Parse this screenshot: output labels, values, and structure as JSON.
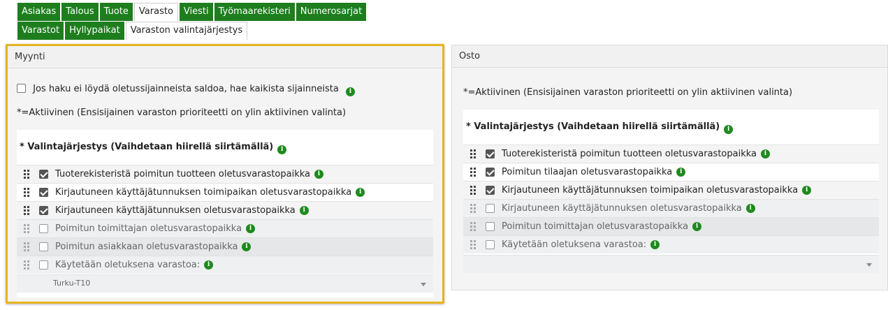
{
  "nav_row1": [
    "Asiakas",
    "Talous",
    "Tuote",
    "Varasto",
    "Viesti",
    "Työmaarekisteri",
    "Numerosarjat"
  ],
  "nav_row1_active": "Varasto",
  "nav_row2": [
    "Varastot",
    "Hyllypaikat",
    "Varaston valintajärjestys"
  ],
  "nav_row2_active": "Varaston valintajärjestys",
  "myynti": {
    "title": "Myynti",
    "fallback_checkbox_label": "Jos haku ei löydä oletussijainneista saldoa, hae kaikista sijainneista",
    "active_note": "*=Aktiivinen (Ensisijainen varaston prioriteetti on ylin aktiivinen valinta)",
    "order_title": "* Valintajärjestys (Vaihdetaan hiirellä siirtämällä)",
    "items": [
      {
        "label": "Tuoterekisteristä poimitun tuotteen oletusvarastopaikka",
        "checked": true
      },
      {
        "label": "Kirjautuneen käyttäjätunnuksen toimipaikan oletusvarastopaikka",
        "checked": true
      },
      {
        "label": "Kirjautuneen käyttäjätunnuksen oletusvarastopaikka",
        "checked": true
      },
      {
        "label": "Poimitun toimittajan oletusvarastopaikka",
        "checked": false
      },
      {
        "label": "Poimitun asiakkaan oletusvarastopaikka",
        "checked": false
      },
      {
        "label": "Käytetään oletuksena varastoa:",
        "checked": false
      }
    ],
    "default_warehouse_value": "Turku-T10"
  },
  "osto": {
    "title": "Osto",
    "active_note": "*=Aktiivinen (Ensisijainen varaston prioriteetti on ylin aktiivinen valinta)",
    "order_title": "* Valintajärjestys (Vaihdetaan hiirellä siirtämällä)",
    "items": [
      {
        "label": "Tuoterekisteristä poimitun tuotteen oletusvarastopaikka",
        "checked": true
      },
      {
        "label": "Poimitun tilaajan oletusvarastopaikka",
        "checked": true
      },
      {
        "label": "Kirjautuneen käyttäjätunnuksen toimipaikan oletusvarastopaikka",
        "checked": true
      },
      {
        "label": "Kirjautuneen käyttäjätunnuksen oletusvarastopaikka",
        "checked": false
      },
      {
        "label": "Poimitun toimittajan oletusvarastopaikka",
        "checked": false
      },
      {
        "label": "Käytetään oletuksena varastoa:",
        "checked": false
      }
    ],
    "default_warehouse_value": ""
  },
  "icons": {
    "info": "info-icon",
    "drag": "drag-handle-icon",
    "dropdown": "chevron-down-icon"
  },
  "colors": {
    "nav_green": "#1e7e1e",
    "highlight": "#e8b323",
    "info_green": "#1e8a1e"
  }
}
